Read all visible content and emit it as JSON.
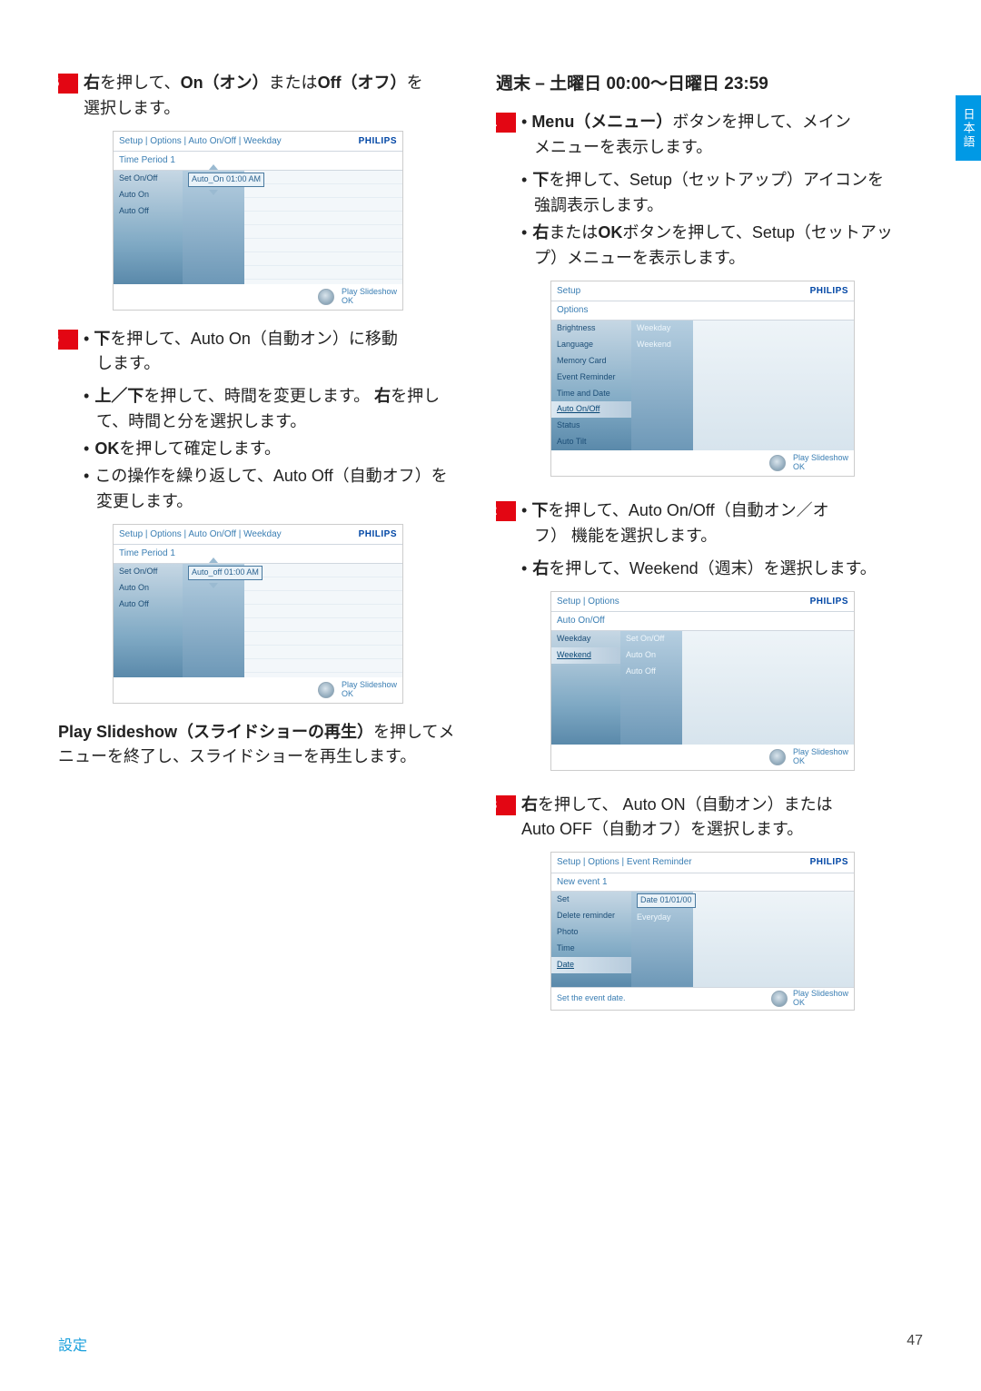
{
  "sideTab": "日本語",
  "footer": {
    "left": "設定",
    "page": "47"
  },
  "left": {
    "step5": "右を押して、On（オン）またはOff（オフ）を選択します。",
    "shot1": {
      "bc": "Setup | Options | Auto On/Off | Weekday",
      "brand": "PHILIPS",
      "sub": "Time Period 1",
      "menu": [
        "Set On/Off",
        "Auto On",
        "Auto Off"
      ],
      "val": "Auto_On   01:00 AM",
      "foot1": "Play Slideshow",
      "foot2": "OK"
    },
    "step6_1": "下を押して、Auto On（自動オン）に移動します。",
    "step6_2": "上／下を押して、時間を変更します。 右を押して、時間と分を選択します。",
    "step6_3": "OKを押して確定します。",
    "step6_4": "この操作を繰り返して、Auto Off（自動オフ）を変更します。",
    "shot2": {
      "bc": "Setup | Options | Auto On/Off | Weekday",
      "brand": "PHILIPS",
      "sub": "Time Period 1",
      "menu": [
        "Set On/Off",
        "Auto On",
        "Auto Off"
      ],
      "val": "Auto_off   01:00 AM",
      "foot1": "Play Slideshow",
      "foot2": "OK"
    },
    "para": "Play Slideshow（スライドショーの再生）を押してメニューを終了し、スライドショーを再生します。"
  },
  "right": {
    "heading": "週末 – 土曜日 00:00～日曜日 23:59",
    "step1_1": "Menu（メニュー）ボタンを押して、メインメニューを表示します。",
    "step1_2": "下を押して、Setup（セットアップ）アイコンを強調表示します。",
    "step1_3": "右またはOKボタンを押して、Setup（セットアップ）メニューを表示します。",
    "shot1": {
      "bc": "Setup",
      "brand": "PHILIPS",
      "sub": "Options",
      "menu": [
        "Brightness",
        "Language",
        "Memory Card",
        "Event Reminder",
        "Time and Date",
        "Auto On/Off",
        "Status",
        "Auto Tilt"
      ],
      "selIndex": 5,
      "menu2": [
        "Weekday",
        "Weekend"
      ],
      "foot1": "Play Slideshow",
      "foot2": "OK"
    },
    "step2_1": "下を押して、Auto On/Off（自動オン／オフ） 機能を選択します。",
    "step2_2": "右を押して、Weekend（週末）を選択します。",
    "shot2": {
      "bc": "Setup | Options",
      "brand": "PHILIPS",
      "sub": "Auto On/Off",
      "menu": [
        "Weekday",
        "Weekend"
      ],
      "selIndex": 1,
      "menu2": [
        "Set On/Off",
        "Auto On",
        "Auto Off"
      ],
      "foot1": "Play Slideshow",
      "foot2": "OK"
    },
    "step3": "右を押して、 Auto ON（自動オン）またはAuto OFF（自動オフ）を選択します。",
    "shot3": {
      "bc": "Setup | Options | Event Reminder",
      "brand": "PHILIPS",
      "sub": "New event 1",
      "menu": [
        "Set",
        "Delete reminder",
        "Photo",
        "Time",
        "Date"
      ],
      "selIndex": 4,
      "menu2": [
        "Date   01/01/00",
        "Everyday"
      ],
      "hint": "Set the event date.",
      "foot1": "Play Slideshow",
      "foot2": "OK"
    }
  }
}
